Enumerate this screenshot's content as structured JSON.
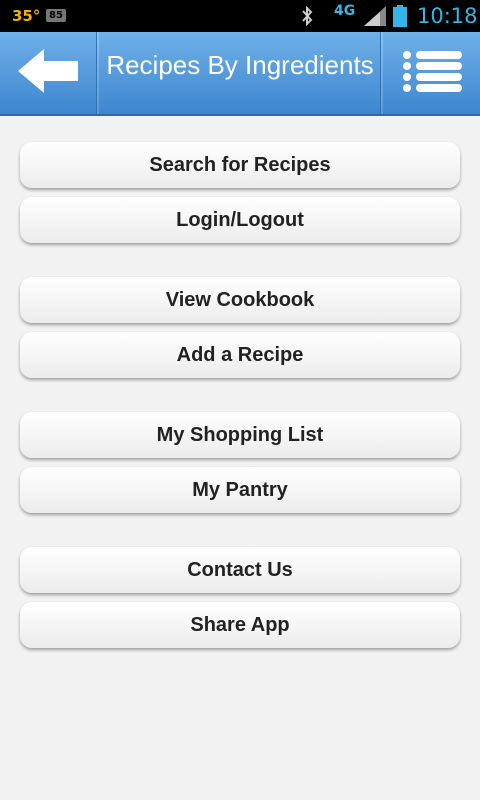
{
  "status_bar": {
    "temperature": "35°",
    "notification_count": "85",
    "network": "4G",
    "time": "10:18"
  },
  "header": {
    "title": "Recipes By Ingredients"
  },
  "menu": {
    "items": [
      {
        "label": "Search for Recipes"
      },
      {
        "label": "Login/Logout"
      },
      {
        "label": "View Cookbook"
      },
      {
        "label": "Add a Recipe"
      },
      {
        "label": "My Shopping List"
      },
      {
        "label": "My Pantry"
      },
      {
        "label": "Contact Us"
      },
      {
        "label": "Share App"
      }
    ]
  },
  "colors": {
    "header_top": "#6fb0e8",
    "header_bottom": "#3d86cf",
    "status_accent": "#33b5e5"
  }
}
